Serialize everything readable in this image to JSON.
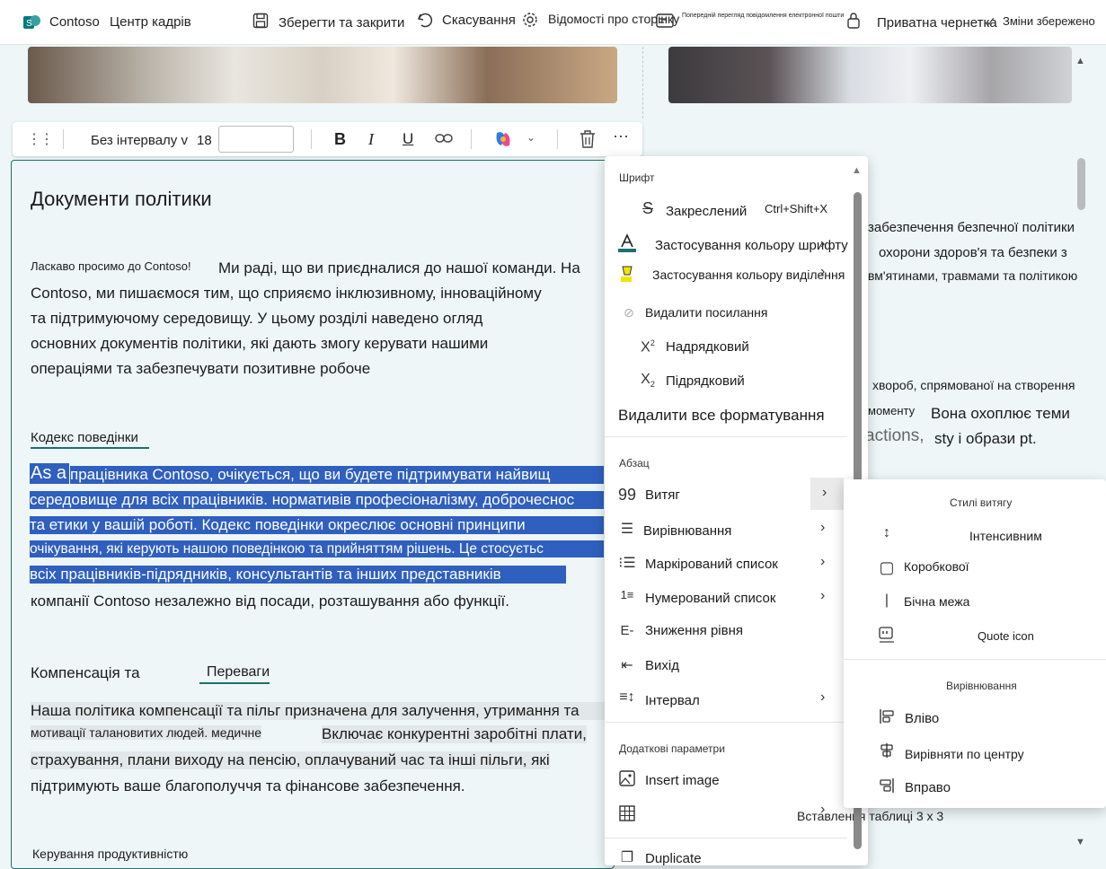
{
  "topbar": {
    "site_name": "Contoso",
    "page_title": "Центр кадрів",
    "save_close": "Зберегти та закрити",
    "discard": "Скасування",
    "page_details": "Відомості про сторінку",
    "email_preview": "Попередній перегляд повідомлення електронної пошти",
    "private_draft": "Приватна чернетка",
    "saved_status": "Зміни збережено"
  },
  "text_toolbar": {
    "style": "Без інтервалу",
    "style_chevron": "v",
    "font_size": "18",
    "font_size_input": ""
  },
  "editor": {
    "heading": "Документи політики",
    "welcome": "Ласкаво просимо до Contoso!",
    "intro_lines": [
      "Ми раді, що ви приєдналися до нашої команди. На",
      "Contoso, ми пишаємося тим, що сприяємо інклюзивному, інноваційному",
      "та підтримуючому середовищу. У цьому розділі наведено огляд",
      "основних документів політики, які дають змогу керувати нашими",
      "операціями та забезпечувати позитивне робоче"
    ],
    "conduct_heading": "Кодекс поведінки",
    "conduct_lines": [
      "As a",
      "працівника Contoso, очікується, що ви будете підтримувати найвищ",
      "середовище для всіх працівників. нормативів професіоналізму, доброчеснос",
      "та етики у вашій роботі. Кодекс поведінки окреслює основні принципи",
      "очікування, які керують нашою поведінкою та прийняттям рішень. Це стосуєтьс",
      "всіх працівників-підрядників, консультантів та інших представників",
      "компанії Contoso незалежно від посади, розташування або функції."
    ],
    "comp_heading_a": "Компенсація та",
    "comp_heading_b": "Переваги",
    "comp_lines": [
      "Наша політика компенсації та пільг призначена для залучення, утримання та",
      "мотивації талановитих людей. медичне",
      "Включає конкурентні заробітні плати,",
      "страхування, плани виходу на пенсію, оплачуваний час та інші пільги, які",
      "підтримують ваше благополуччя та фінансове забезпечення."
    ],
    "perf_heading": "Керування продуктивністю"
  },
  "right_column": {
    "lines": [
      "забезпечення безпечної політики",
      "охорони здоров'я та безпеки з",
      "вм'ятинами, травмами та політикою",
      "хвороб, спрямованої на створення",
      "моменту",
      "Вона охоплює теми",
      "actions,",
      "sty і образи pt."
    ]
  },
  "menu": {
    "font_section": "Шрифт",
    "strikethrough": "Закреслений",
    "strikethrough_shortcut": "Ctrl+Shift+X",
    "font_color": "Застосування кольору шрифту",
    "highlight_color": "Застосування кольору виділення",
    "remove_link": "Видалити посилання",
    "superscript": "Надрядковий",
    "subscript": "Підрядковий",
    "clear_formatting": "Видалити все форматування",
    "paragraph_section": "Абзац",
    "quote": "Витяг",
    "alignment": "Вирівнювання",
    "bulleted_list": "Маркірований список",
    "numbered_list": "Нумерований список",
    "decrease_indent": "Зниження рівня",
    "outdent": "Вихід",
    "spacing": "Інтервал",
    "more_section": "Додаткові параметри",
    "insert_image": "Insert image",
    "insert_table": "Вставлення таблиці 3 x 3",
    "duplicate": "Duplicate"
  },
  "submenu": {
    "quote_styles": "Стилі витягу",
    "intensive": "Інтенсивним",
    "boxed": "Коробкової",
    "side_border": "Бічна межа",
    "quote_icon": "Quote icon",
    "alignment_section": "Вирівнювання",
    "align_left": "Вліво",
    "align_center": "Вирівняти по центру",
    "align_right": "Вправо"
  },
  "colors": {
    "accent": "#1f6f6c",
    "selection": "#2f5fbf",
    "background": "#eef6f7",
    "font_color_bar": "#1f6f6c",
    "highlight_yellow": "#f2e600"
  }
}
